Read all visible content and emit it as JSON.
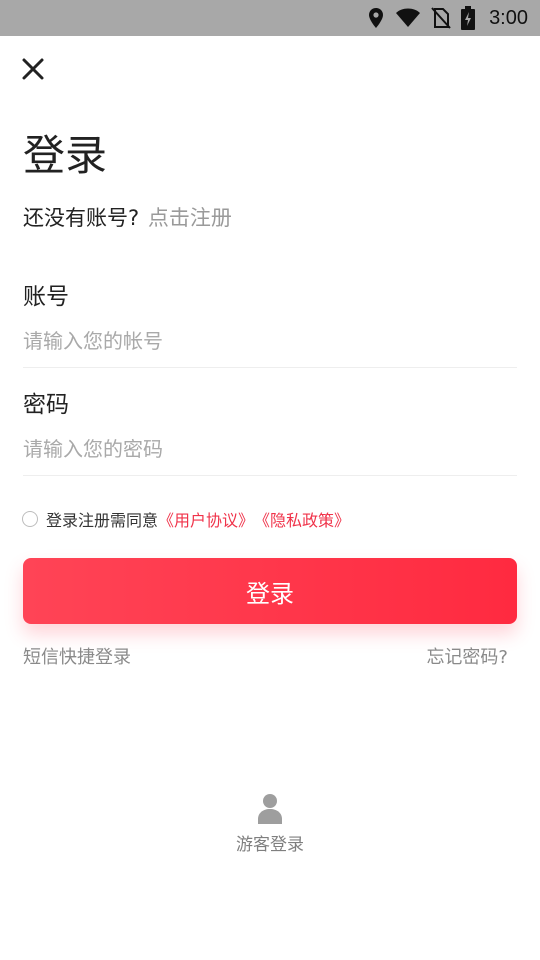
{
  "status_bar": {
    "time": "3:00",
    "icons": [
      "location-icon",
      "wifi-icon",
      "no-sim-icon",
      "battery-charging-icon"
    ]
  },
  "header": {
    "close_icon": "close-icon"
  },
  "title": "登录",
  "register": {
    "prompt": "还没有账号?",
    "link": "点击注册"
  },
  "account": {
    "label": "账号",
    "placeholder": "请输入您的帐号",
    "value": ""
  },
  "password": {
    "label": "密码",
    "placeholder": "请输入您的密码",
    "value": ""
  },
  "agreement": {
    "checked": false,
    "text": "登录注册需同意",
    "user_agreement": "《用户协议》",
    "privacy_policy": "《隐私政策》"
  },
  "login_button": "登录",
  "sms_login": "短信快捷登录",
  "forgot_password": "忘记密码?",
  "guest_login": {
    "label": "游客登录",
    "icon": "person-icon"
  },
  "colors": {
    "accent": "#ff3347",
    "status_bar": "#a8a8a8",
    "muted_text": "#8a8a8a"
  }
}
